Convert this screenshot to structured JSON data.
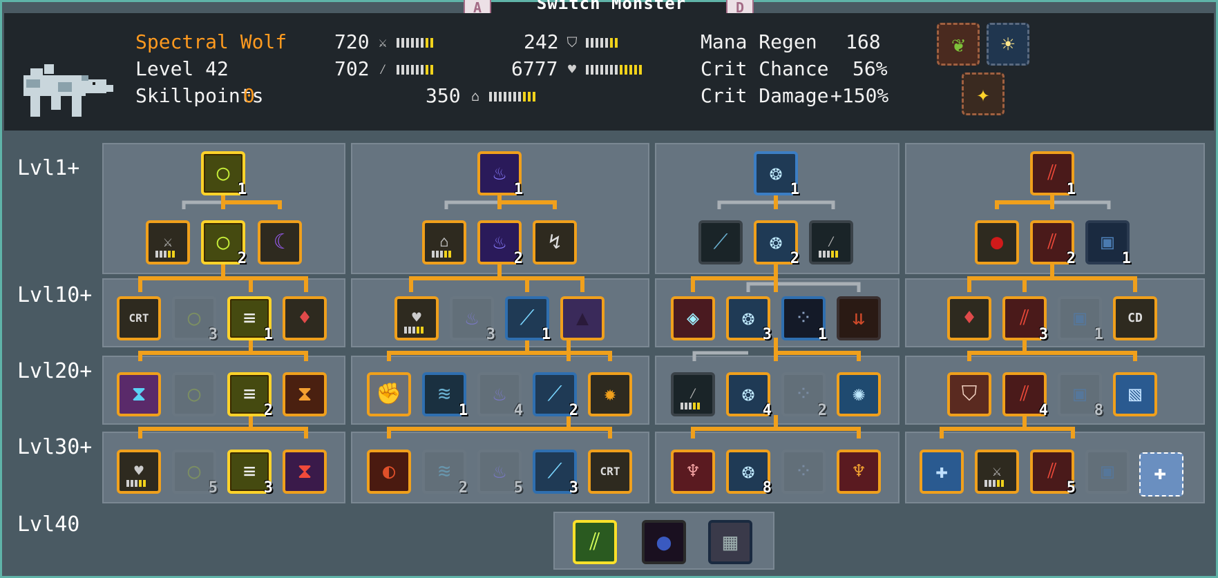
{
  "header": {
    "switch_key_left": "A",
    "switch_title": "Switch Monster",
    "switch_key_right": "D",
    "monster_name": "Spectral Wolf",
    "level_label": "Level 42",
    "skillpoints_label": "Skillpoints",
    "skillpoints_value": "0",
    "stats": {
      "attack": "720",
      "magic_attack": "702",
      "defense": "242",
      "health": "6777",
      "speed": "350"
    },
    "regen_label": "Mana Regen",
    "regen_value": "168",
    "crit_chance_label": "Crit Chance",
    "crit_chance_value": "56%",
    "crit_damage_label": "Crit Damage",
    "crit_damage_value": "+150%"
  },
  "row_labels": [
    "Lvl1+",
    "Lvl10+",
    "Lvl20+",
    "Lvl30+",
    "Lvl40"
  ],
  "colors": {
    "accent": "#f0a01c",
    "selected": "#ffd32a",
    "name": "#ff9a1f",
    "border": "#5fb3a8"
  },
  "trees": {
    "t1": {
      "n1": "1",
      "n3": "2",
      "n6": "3",
      "n7": "1",
      "n10": "2",
      "n14": "5",
      "n15": "3"
    },
    "t2": {
      "n1": "1",
      "n3": "2",
      "n6": "3",
      "n7": "1",
      "n10": "1",
      "n12": "4",
      "n13": "2",
      "n16": "2",
      "n17": "5",
      "n18": "3"
    },
    "t3": {
      "n1": "1",
      "n3": "2",
      "n6": "3",
      "n7": "1",
      "n10": "4",
      "n11": "2",
      "n15": "8"
    },
    "t4": {
      "n1": "1",
      "n3": "2",
      "n4": "1",
      "n6": "3",
      "n7": "1",
      "n9": "4",
      "n10": "8",
      "n13": "5"
    }
  },
  "icons": {
    "crt": "CRT",
    "cd": "CD"
  }
}
